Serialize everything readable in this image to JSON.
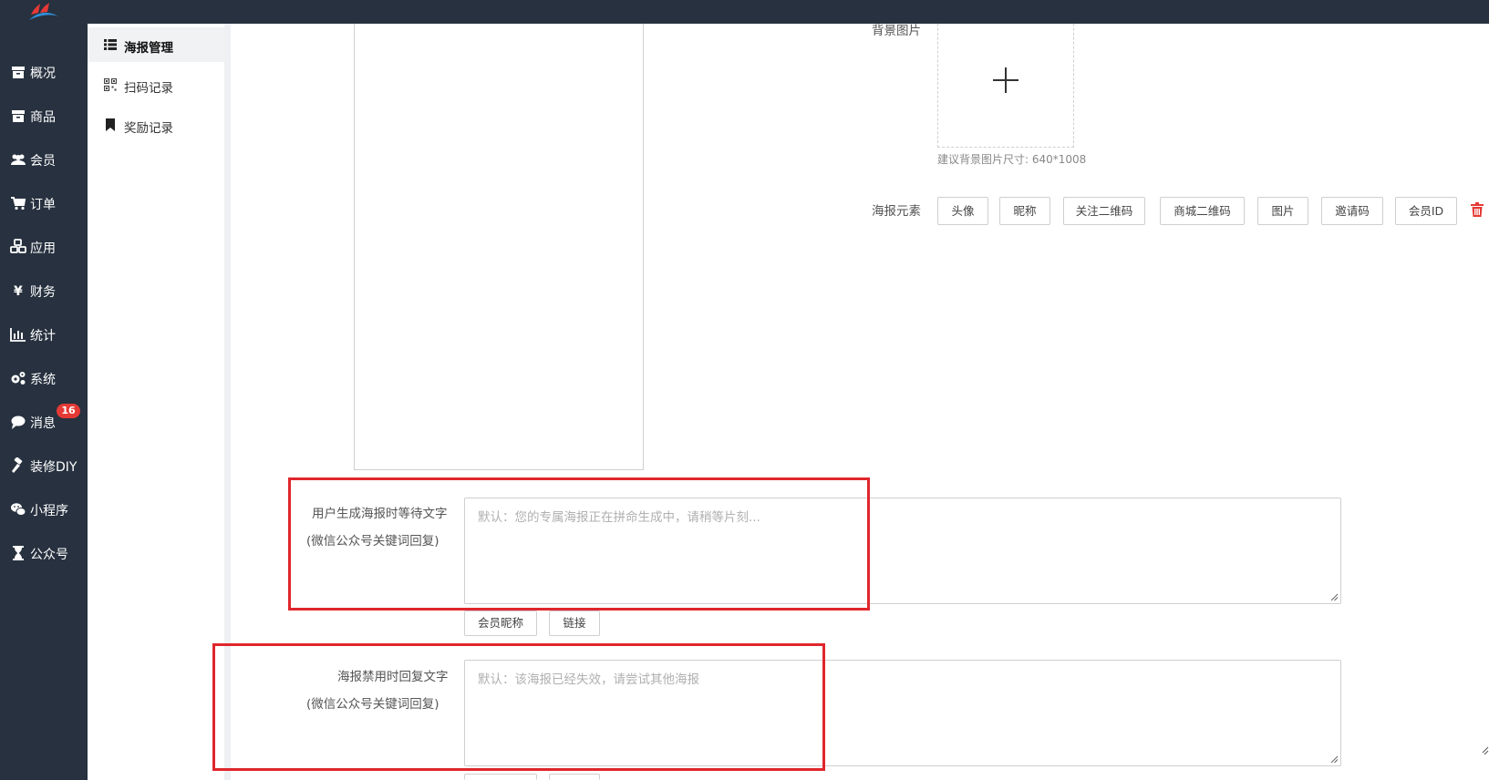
{
  "nav": {
    "items": [
      {
        "label": "概况",
        "icon": "archive-icon"
      },
      {
        "label": "商品",
        "icon": "archive-icon"
      },
      {
        "label": "会员",
        "icon": "users-icon"
      },
      {
        "label": "订单",
        "icon": "cart-icon"
      },
      {
        "label": "应用",
        "icon": "cubes-icon"
      },
      {
        "label": "财务",
        "icon": "yen-icon"
      },
      {
        "label": "统计",
        "icon": "bar-chart-icon"
      },
      {
        "label": "系统",
        "icon": "gears-icon"
      },
      {
        "label": "消息",
        "icon": "chat-bubble-icon",
        "badge": "16"
      },
      {
        "label": "装修DIY",
        "icon": "gavel-icon"
      },
      {
        "label": "小程序",
        "icon": "wechat-icon"
      },
      {
        "label": "公众号",
        "icon": "hourglass-icon"
      }
    ]
  },
  "submenu": {
    "items": [
      {
        "label": "海报管理",
        "icon": "list-icon",
        "active": true
      },
      {
        "label": "扫码记录",
        "icon": "qrcode-icon",
        "active": false
      },
      {
        "label": "奖励记录",
        "icon": "bookmark-icon",
        "active": false
      }
    ]
  },
  "form": {
    "bg_image_label": "背景图片",
    "bg_image_hint": "建议背景图片尺寸: 640*1008",
    "elements_label": "海报元素",
    "elements": [
      "头像",
      "昵称",
      "关注二维码",
      "商城二维码",
      "图片",
      "邀请码",
      "会员ID"
    ],
    "wait_text": {
      "label": "用户生成海报时等待文字",
      "sublabel": "(微信公众号关键词回复)",
      "placeholder": "默认：您的专属海报正在拼命生成中，请稍等片刻...",
      "buttons": [
        "会员昵称",
        "链接"
      ]
    },
    "disabled_text": {
      "label": "海报禁用时回复文字",
      "sublabel": "(微信公众号关键词回复)",
      "placeholder": "默认：该海报已经失效，请尝试其他海报"
    }
  },
  "colors": {
    "sidebar_bg": "#27313f",
    "highlight": "#e0262c",
    "badge": "#e53935",
    "trash": "#e53935"
  }
}
